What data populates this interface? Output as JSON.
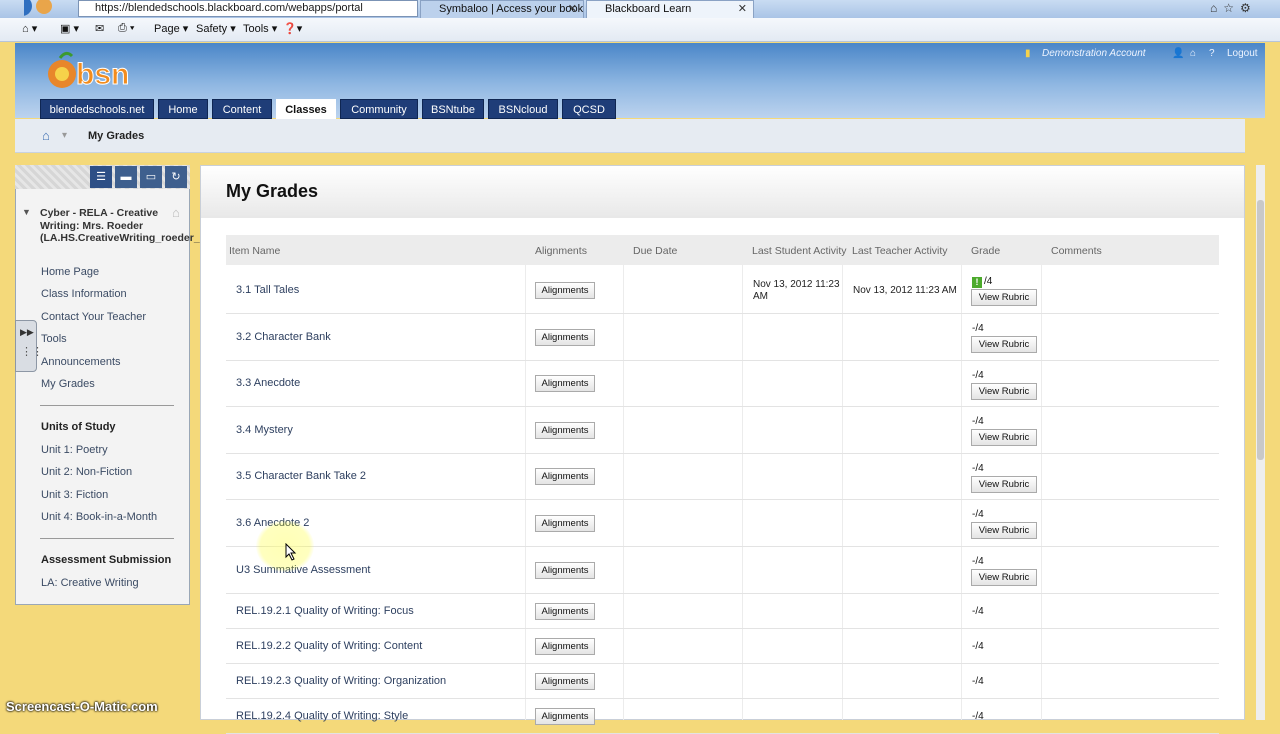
{
  "browser": {
    "address": "https://blendedschools.blackboard.com/webapps/portal",
    "tabs": [
      {
        "label": "Symbaloo | Access your book..."
      },
      {
        "label": "Blackboard Learn"
      }
    ],
    "toolbar": {
      "page": "Page ▾",
      "safety": "Safety ▾",
      "tools": "Tools ▾",
      "help": "❓▾"
    }
  },
  "header": {
    "logo": "bsn",
    "account": "Demonstration Account",
    "logout": "Logout",
    "nav_tabs": [
      "blendedschools.net",
      "Home",
      "Content",
      "Classes",
      "Community",
      "BSNtube",
      "BSNcloud",
      "QCSD"
    ],
    "active_tab": "Classes"
  },
  "breadcrumb": {
    "current": "My Grades"
  },
  "sidebar": {
    "course_title": "Cyber - RELA - Creative Writing: Mrs. Roeder (LA.HS.CreativeWriting_roeder_cybercourse.qc)",
    "items": [
      "Home Page",
      "Class Information",
      "Contact Your Teacher",
      "Tools",
      "Announcements",
      "My Grades"
    ],
    "section1": {
      "title": "Units of Study",
      "items": [
        "Unit 1: Poetry",
        "Unit 2: Non-Fiction",
        "Unit 3: Fiction",
        "Unit 4: Book-in-a-Month"
      ]
    },
    "section2": {
      "title": "Assessment Submission",
      "items": [
        "LA: Creative Writing"
      ]
    }
  },
  "main": {
    "title": "My Grades",
    "columns": [
      "Item Name",
      "Alignments",
      "Due Date",
      "Last Student Activity",
      "Last Teacher Activity",
      "Grade",
      "Comments"
    ],
    "alignments_label": "Alignments",
    "rubric_label": "View Rubric",
    "rows": [
      {
        "name": "3.1 Tall Tales",
        "student": "Nov 13, 2012 11:23 AM",
        "teacher": "Nov 13, 2012 11:23 AM",
        "grade": "/4",
        "rubric": true,
        "flag": true
      },
      {
        "name": "3.2 Character Bank",
        "grade": "-/4",
        "rubric": true
      },
      {
        "name": "3.3 Anecdote",
        "grade": "-/4",
        "rubric": true
      },
      {
        "name": "3.4 Mystery",
        "grade": "-/4",
        "rubric": true
      },
      {
        "name": "3.5 Character Bank Take 2",
        "grade": "-/4",
        "rubric": true
      },
      {
        "name": "3.6 Anecdote 2",
        "grade": "-/4",
        "rubric": true
      },
      {
        "name": "U3 Summative Assessment",
        "grade": "-/4",
        "rubric": true
      },
      {
        "name": "REL.19.2.1 Quality of Writing: Focus",
        "grade": "-/4",
        "rubric": false
      },
      {
        "name": "REL.19.2.2 Quality of Writing: Content",
        "grade": "-/4",
        "rubric": false
      },
      {
        "name": "REL.19.2.3 Quality of Writing: Organization",
        "grade": "-/4",
        "rubric": false
      },
      {
        "name": "REL.19.2.4 Quality of Writing: Style",
        "grade": "-/4",
        "rubric": false
      }
    ]
  },
  "watermark": "Screencast-O-Matic.com",
  "colors": {
    "nav": "#1f3d78",
    "header": "#4a86c8",
    "page_bg": "#f4d97a"
  }
}
